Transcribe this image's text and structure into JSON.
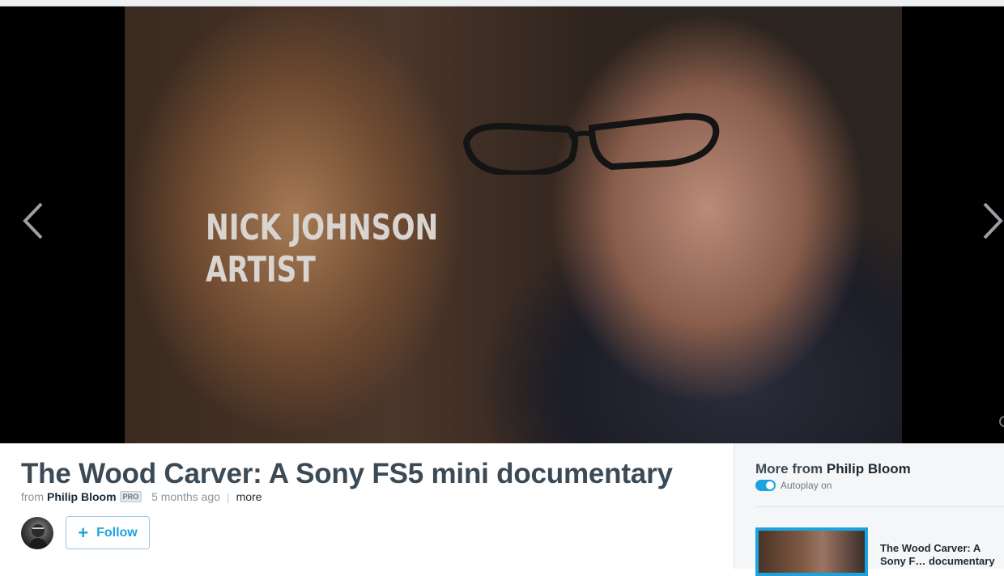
{
  "video": {
    "lower_third_line1": "NICK JOHNSON",
    "lower_third_line2": "ARTIST"
  },
  "info": {
    "title": "The Wood Carver: A Sony FS5 mini documentary",
    "from_label": "from",
    "author": "Philip Bloom",
    "pro_badge": "PRO",
    "time_ago": "5 months ago",
    "separator": "|",
    "more_label": "more",
    "follow_label": "Follow",
    "follow_plus": "+"
  },
  "sidebar": {
    "title_prefix": "More from",
    "title_author": "Philip Bloom",
    "autoplay_label": "Autoplay on",
    "autoplay_on": true,
    "items": [
      {
        "title": "The Wood Carver: A Sony F… documentary"
      }
    ]
  },
  "colors": {
    "accent": "#1aa3de",
    "title_text": "#3b4a55",
    "muted_text": "#8a959e"
  },
  "icons": {
    "prev": "chevron-left-icon",
    "next": "chevron-right-icon",
    "follow": "plus-icon"
  }
}
